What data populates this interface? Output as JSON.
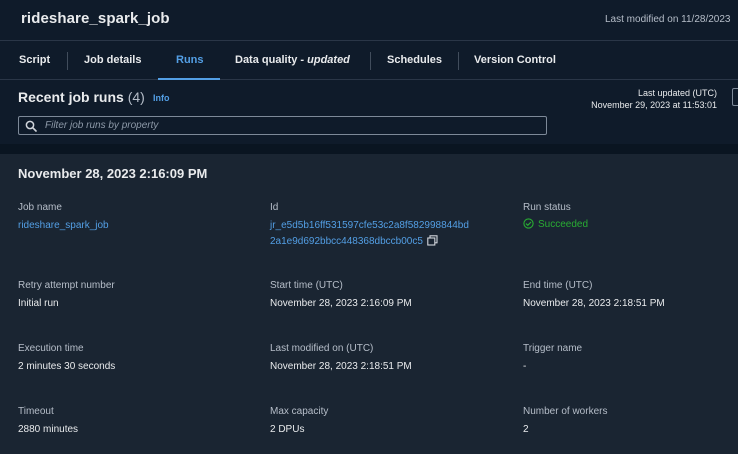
{
  "header": {
    "job_title": "rideshare_spark_job",
    "last_modified": "Last modified on 11/28/2023"
  },
  "tabs": [
    {
      "label": "Script"
    },
    {
      "label": "Job details"
    },
    {
      "label": "Runs",
      "active": true
    },
    {
      "label": "Data quality - ",
      "suffix": "updated"
    },
    {
      "label": "Schedules"
    },
    {
      "label": "Version Control"
    }
  ],
  "recent_runs": {
    "title": "Recent job runs",
    "count": "(4)",
    "info_label": "Info",
    "last_updated_label": "Last updated (UTC)",
    "last_updated_value": "November 29, 2023 at 11:53:01",
    "search_placeholder": "Filter job runs by property"
  },
  "run": {
    "header": "November 28, 2023 2:16:09 PM",
    "fields": {
      "job_name": {
        "label": "Job name",
        "value": "rideshare_spark_job"
      },
      "id": {
        "label": "Id",
        "value_line1": "jr_e5d5b16ff531597cfe53c2a8f582998844bd",
        "value_line2": "2a1e9d692bbcc448368dbccb00c5"
      },
      "run_status": {
        "label": "Run status",
        "value": "Succeeded"
      },
      "retry_attempt": {
        "label": "Retry attempt number",
        "value": "Initial run"
      },
      "start_time": {
        "label": "Start time (UTC)",
        "value": "November 28, 2023 2:16:09 PM"
      },
      "end_time": {
        "label": "End time (UTC)",
        "value": "November 28, 2023 2:18:51 PM"
      },
      "execution_time": {
        "label": "Execution time",
        "value": "2 minutes 30 seconds"
      },
      "last_modified_on": {
        "label": "Last modified on (UTC)",
        "value": "November 28, 2023 2:18:51 PM"
      },
      "trigger_name": {
        "label": "Trigger name",
        "value": "-"
      },
      "timeout": {
        "label": "Timeout",
        "value": "2880 minutes"
      },
      "max_capacity": {
        "label": "Max capacity",
        "value": "2 DPUs"
      },
      "num_workers": {
        "label": "Number of workers",
        "value": "2"
      }
    }
  },
  "colors": {
    "accent": "#539fe5",
    "success": "#29ad32",
    "background": "#0f1b2a",
    "panel": "#1a2532"
  },
  "icons": {
    "search": "search-icon",
    "copy": "copy-icon",
    "status": "check-circle-icon"
  }
}
